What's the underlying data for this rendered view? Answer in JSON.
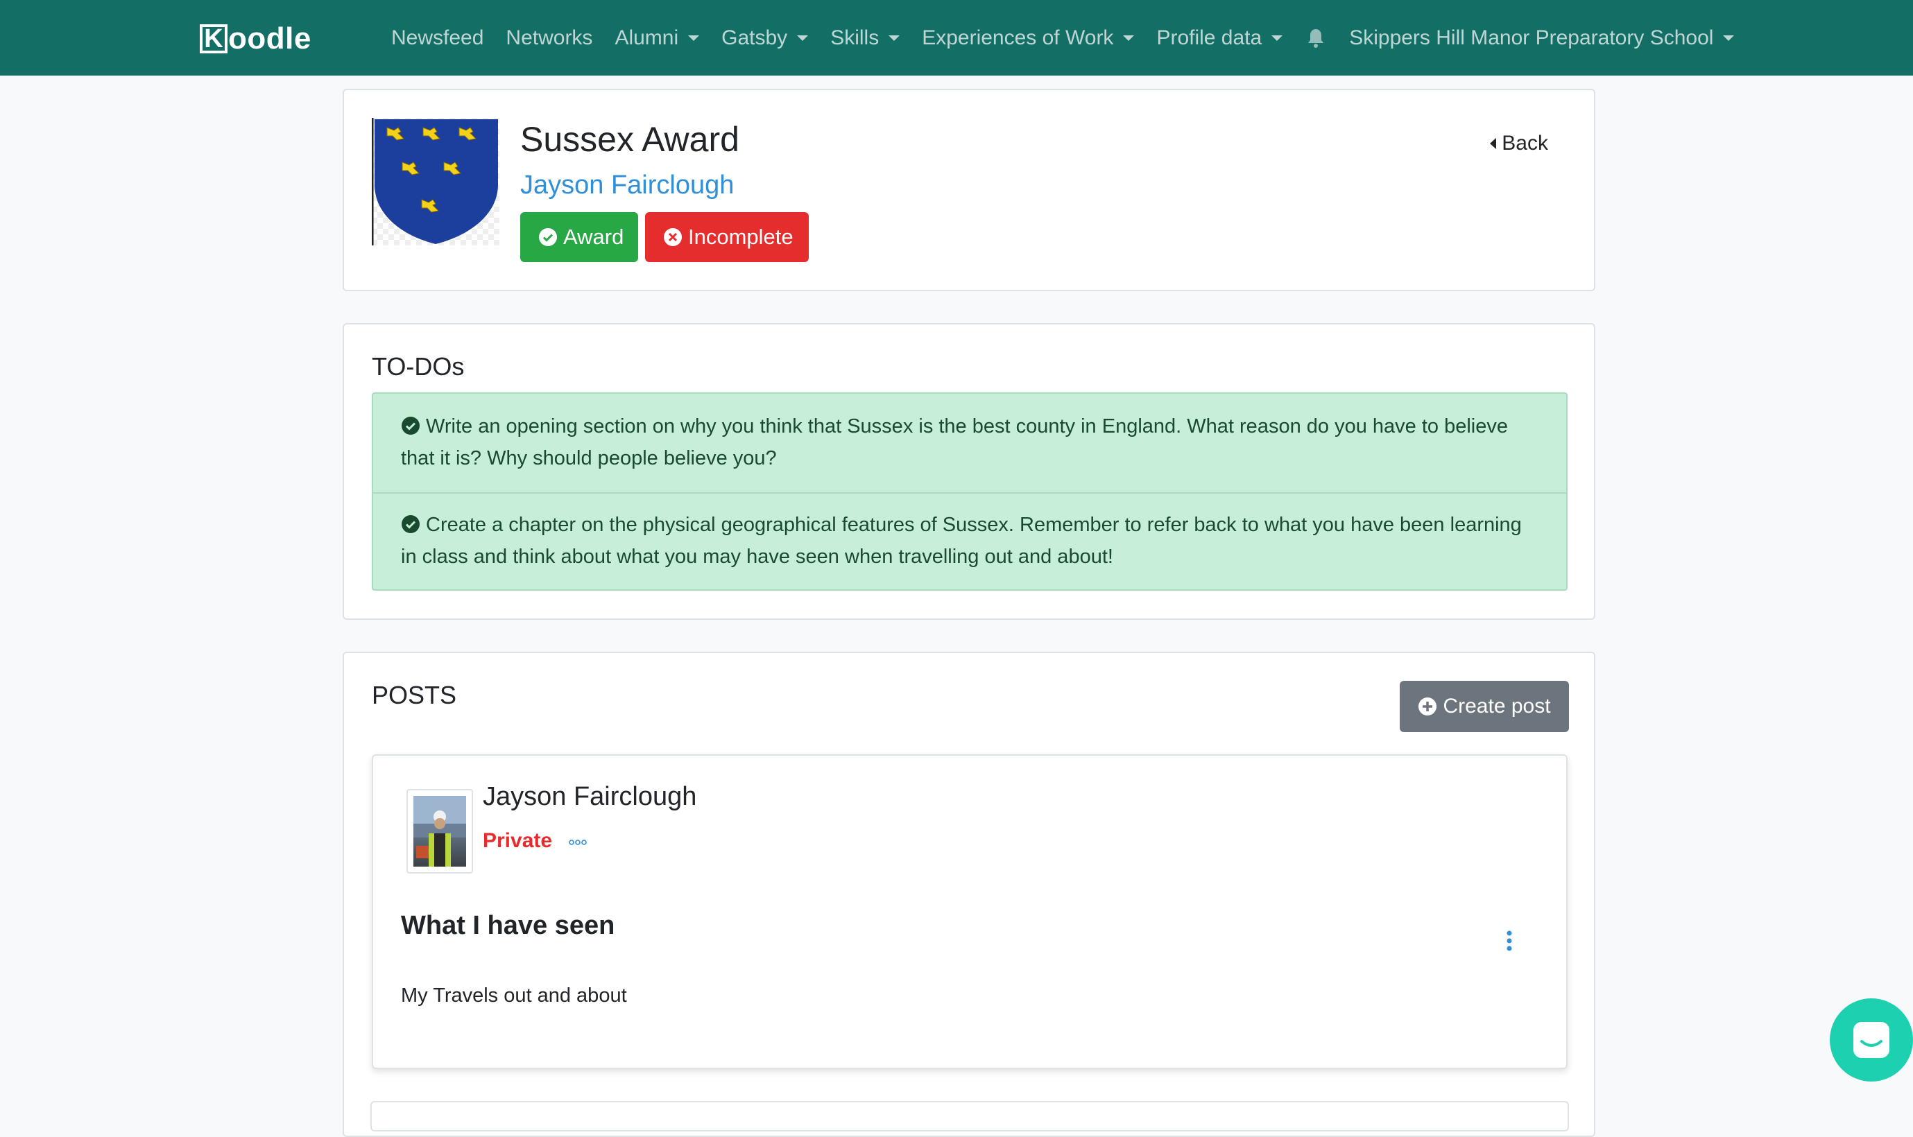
{
  "navbar": {
    "logo_k": "K",
    "logo_rest": "oodle",
    "items": [
      {
        "label": "Newsfeed",
        "dropdown": false
      },
      {
        "label": "Networks",
        "dropdown": false
      },
      {
        "label": "Alumni",
        "dropdown": true
      },
      {
        "label": "Gatsby",
        "dropdown": true
      },
      {
        "label": "Skills",
        "dropdown": true
      },
      {
        "label": "Experiences of Work",
        "dropdown": true
      },
      {
        "label": "Profile data",
        "dropdown": true
      }
    ],
    "school": "Skippers Hill Manor Preparatory School",
    "bell_icon": "bell-icon",
    "background": "#136e66"
  },
  "award": {
    "title": "Sussex Award",
    "user": "Jayson Fairclough",
    "award_label": "Award",
    "status_label": "Incomplete",
    "back_label": "Back",
    "crest_icon": "sussex-crest-icon",
    "colors": {
      "award": "#28a745",
      "incomplete": "#e52d2d"
    }
  },
  "todos": {
    "title": "TO-DOs",
    "items": [
      "Write an opening section on why you think that Sussex is the best county in England. What reason do you have to believe that it is? Why should people believe you?",
      "Create a chapter on the physical geographical features of Sussex. Remember to refer back to what you have been learning in class and think about what you may have seen when travelling out and about!"
    ]
  },
  "posts": {
    "title": "POSTS",
    "create_label": "Create post",
    "items": [
      {
        "author": "Jayson Fairclough",
        "privacy": "Private",
        "title": "What I have seen",
        "body": "My Travels out and about"
      }
    ]
  }
}
